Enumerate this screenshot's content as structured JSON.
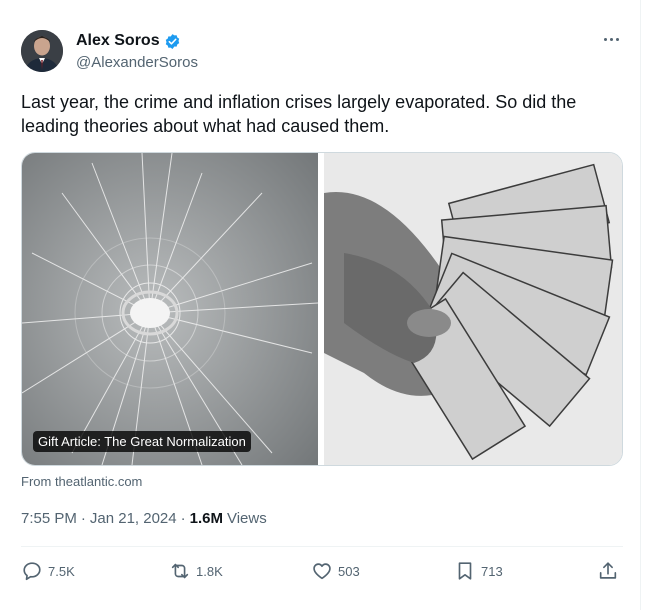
{
  "author": {
    "name": "Alex Soros",
    "handle": "@AlexanderSoros",
    "verified_color": "#1d9bf0"
  },
  "tweet": {
    "text": "Last year, the crime and inflation crises largely evaporated. So did the leading theories about what had caused them."
  },
  "card": {
    "label": "Gift Article: The Great Normalization",
    "source": "From theatlantic.com"
  },
  "meta": {
    "time": "7:55 PM",
    "dot1": "·",
    "date": "Jan 21, 2024",
    "dot2": "·",
    "views_count": "1.6M",
    "views_label": "Views"
  },
  "actions": {
    "replies": "7.5K",
    "reposts": "1.8K",
    "likes": "503",
    "bookmarks": "713"
  },
  "icons": [
    "verified-badge-icon",
    "more-icon",
    "reply-icon",
    "repost-icon",
    "like-icon",
    "bookmark-icon",
    "share-icon"
  ]
}
